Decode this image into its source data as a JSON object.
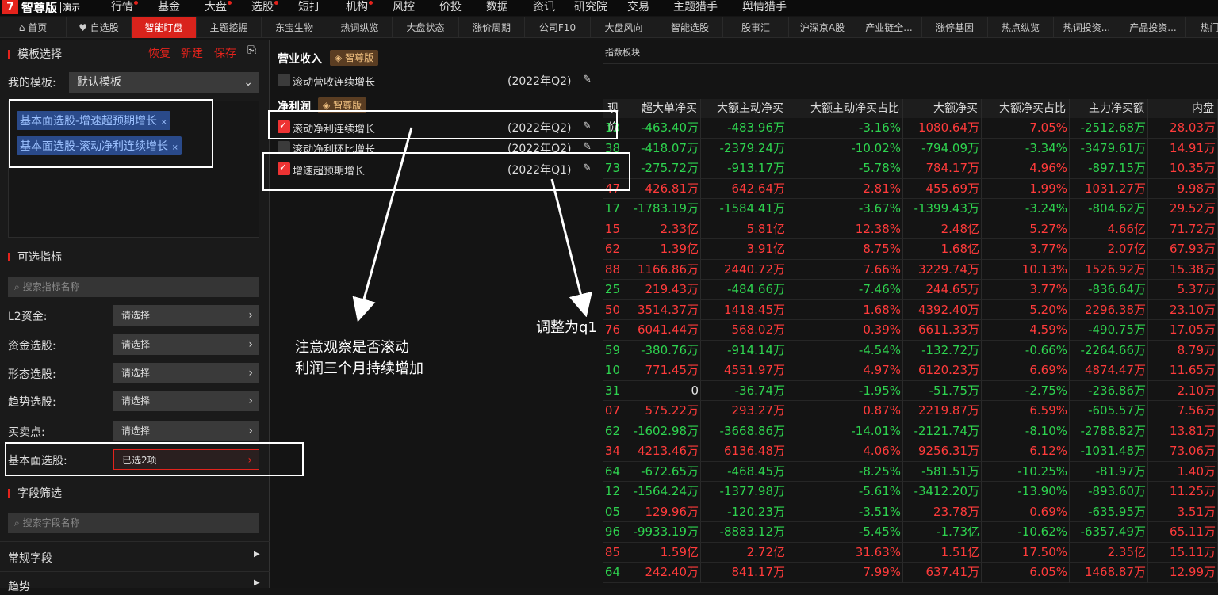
{
  "app": {
    "logo_mark": "7",
    "name": "智尊版",
    "demo": "演示"
  },
  "top_nav": [
    {
      "label": "行情",
      "dot": true
    },
    {
      "label": "基金",
      "dot": false
    },
    {
      "label": "大盘",
      "dot": true
    },
    {
      "label": "选股",
      "dot": true
    },
    {
      "label": "短打",
      "dot": false
    },
    {
      "label": "机构",
      "dot": true
    },
    {
      "label": "风控",
      "dot": false
    },
    {
      "label": "价投",
      "dot": false
    },
    {
      "label": "数据",
      "dot": false
    },
    {
      "label": "资讯",
      "dot": false
    },
    {
      "label": "研究院",
      "dot": false
    },
    {
      "label": "交易",
      "dot": false
    },
    {
      "label": "主题猎手",
      "dot": false
    },
    {
      "label": "舆情猎手",
      "dot": false
    }
  ],
  "tabs": [
    "首页",
    "自选股",
    "智能盯盘",
    "主题挖掘",
    "东宝生物",
    "热词纵览",
    "大盘状态",
    "涨价周期",
    "公司F10",
    "大盘风向",
    "智能选股",
    "股事汇",
    "沪深京A股",
    "产业链全...",
    "涨停基因",
    "热点纵览",
    "热词投资...",
    "产品投资...",
    "热门"
  ],
  "left": {
    "template_header": "模板选择",
    "restore": "恢复",
    "create": "新建",
    "save": "保存",
    "my_template_label": "我的模板:",
    "my_template_value": "默认模板",
    "tags": [
      "基本面选股-增速超预期增长",
      "基本面选股-滚动净利连续增长"
    ],
    "indicators_header": "可选指标",
    "indicator_search_placeholder": "搜索指标名称",
    "rows": [
      {
        "label": "L2资金:",
        "value": "请选择"
      },
      {
        "label": "资金选股:",
        "value": "请选择"
      },
      {
        "label": "形态选股:",
        "value": "请选择"
      },
      {
        "label": "趋势选股:",
        "value": "请选择"
      },
      {
        "label": "买卖点:",
        "value": "请选择"
      },
      {
        "label": "基本面选股:",
        "value": "已选2项"
      }
    ],
    "fields_header": "字段筛选",
    "field_search_placeholder": "搜索字段名称",
    "field_groups": [
      "常规字段",
      "趋势"
    ]
  },
  "mid": {
    "revenue_header": "营业收入",
    "badge": "智尊版",
    "revenue_cond": {
      "label": "滚动营收连续增长",
      "period": "(2022年Q2)"
    },
    "profit_header": "净利润",
    "conds": [
      {
        "label": "滚动净利连续增长",
        "period": "(2022年Q2)",
        "checked": true
      },
      {
        "label": "滚动净利环比增长",
        "period": "(2022年Q2)",
        "checked": false
      },
      {
        "label": "增速超预期增长",
        "period": "(2022年Q1)",
        "checked": true
      }
    ],
    "note1": [
      "注意观察是否滚动",
      "利润三个月持续增加"
    ],
    "note2": "调整为q1"
  },
  "grid": {
    "sector_label": "指数板块",
    "headers": [
      "现价",
      "超大单净买",
      "大额主动净买",
      "大额主动净买占比",
      "大额净买",
      "大额净买占比",
      "主力净买额",
      "内盘"
    ],
    "rows": [
      [
        "13",
        "-463.40万",
        "-483.96万",
        "-3.16%",
        "1080.64万",
        "7.05%",
        "-2512.68万",
        "28.03万"
      ],
      [
        "38",
        "-418.07万",
        "-2379.24万",
        "-10.02%",
        "-794.09万",
        "-3.34%",
        "-3479.61万",
        "14.91万"
      ],
      [
        "73",
        "-275.72万",
        "-913.17万",
        "-5.78%",
        "784.17万",
        "4.96%",
        "-897.15万",
        "10.35万"
      ],
      [
        "47",
        "426.81万",
        "642.64万",
        "2.81%",
        "455.69万",
        "1.99%",
        "1031.27万",
        "9.98万"
      ],
      [
        "17",
        "-1783.19万",
        "-1584.41万",
        "-3.67%",
        "-1399.43万",
        "-3.24%",
        "-804.62万",
        "29.52万"
      ],
      [
        "15",
        "2.33亿",
        "5.81亿",
        "12.38%",
        "2.48亿",
        "5.27%",
        "4.66亿",
        "71.72万"
      ],
      [
        "62",
        "1.39亿",
        "3.91亿",
        "8.75%",
        "1.68亿",
        "3.77%",
        "2.07亿",
        "67.93万"
      ],
      [
        "88",
        "1166.86万",
        "2440.72万",
        "7.66%",
        "3229.74万",
        "10.13%",
        "1526.92万",
        "15.38万"
      ],
      [
        "25",
        "219.43万",
        "-484.66万",
        "-7.46%",
        "244.65万",
        "3.77%",
        "-836.64万",
        "5.37万"
      ],
      [
        "50",
        "3514.37万",
        "1418.45万",
        "1.68%",
        "4392.40万",
        "5.20%",
        "2296.38万",
        "23.10万"
      ],
      [
        "76",
        "6041.44万",
        "568.02万",
        "0.39%",
        "6611.33万",
        "4.59%",
        "-490.75万",
        "17.05万"
      ],
      [
        "59",
        "-380.76万",
        "-914.14万",
        "-4.54%",
        "-132.72万",
        "-0.66%",
        "-2264.66万",
        "8.79万"
      ],
      [
        "10",
        "771.45万",
        "4551.97万",
        "4.97%",
        "6120.23万",
        "6.69%",
        "4874.47万",
        "11.65万"
      ],
      [
        "31",
        "0",
        "-36.74万",
        "-1.95%",
        "-51.75万",
        "-2.75%",
        "-236.86万",
        "2.10万"
      ],
      [
        "07",
        "575.22万",
        "293.27万",
        "0.87%",
        "2219.87万",
        "6.59%",
        "-605.57万",
        "7.56万"
      ],
      [
        "62",
        "-1602.98万",
        "-3668.86万",
        "-14.01%",
        "-2121.74万",
        "-8.10%",
        "-2788.82万",
        "13.81万"
      ],
      [
        "34",
        "4213.46万",
        "6136.48万",
        "4.06%",
        "9256.31万",
        "6.12%",
        "-1031.48万",
        "73.06万"
      ],
      [
        "64",
        "-672.65万",
        "-468.45万",
        "-8.25%",
        "-581.51万",
        "-10.25%",
        "-81.97万",
        "1.40万"
      ],
      [
        "12",
        "-1564.24万",
        "-1377.98万",
        "-5.61%",
        "-3412.20万",
        "-13.90%",
        "-893.60万",
        "11.25万"
      ],
      [
        "05",
        "129.96万",
        "-120.23万",
        "-3.51%",
        "23.78万",
        "0.69%",
        "-635.95万",
        "3.51万"
      ],
      [
        "96",
        "-9933.19万",
        "-8883.12万",
        "-5.45%",
        "-1.73亿",
        "-10.62%",
        "-6357.49万",
        "65.11万"
      ],
      [
        "85",
        "1.59亿",
        "2.72亿",
        "31.63%",
        "1.51亿",
        "17.50%",
        "2.35亿",
        "15.11万"
      ],
      [
        "64",
        "242.40万",
        "841.17万",
        "7.99%",
        "637.41万",
        "6.05%",
        "1468.87万",
        "12.99万"
      ]
    ],
    "price_colors": [
      "green",
      "green",
      "green",
      "red",
      "green",
      "red",
      "red",
      "red",
      "green",
      "red",
      "red",
      "green",
      "green",
      "green",
      "red",
      "green",
      "red",
      "green",
      "green",
      "green",
      "green",
      "red",
      "green"
    ]
  }
}
